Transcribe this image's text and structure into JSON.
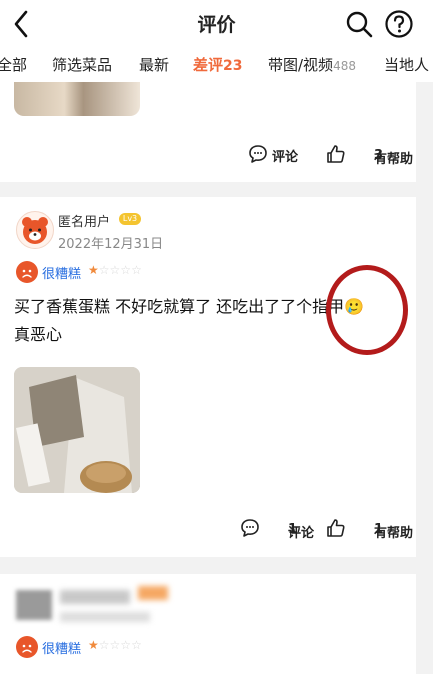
{
  "header": {
    "title": "评价"
  },
  "tabs": [
    {
      "label": "全部"
    },
    {
      "label": "筛选菜品"
    },
    {
      "label": "最新"
    },
    {
      "label": "差评",
      "count": "23"
    },
    {
      "label": "带图/视频",
      "count": "488"
    },
    {
      "label": "当地人"
    }
  ],
  "card1": {
    "comment_label": "评论",
    "helpful_label": "有帮助",
    "helpful_count": "3"
  },
  "review": {
    "username": "匿名用户",
    "level": "Lv3",
    "date": "2022年12月31日",
    "rating_label": "很糟糕",
    "rating": 1,
    "rating_max": 5,
    "text_line1": "买了香蕉蛋糕 不好吃就算了 还吃出了了个指甲🥲",
    "text_line2": "真恶心",
    "comment_label": "评论",
    "comment_count": "1",
    "helpful_label": "有帮助",
    "helpful_count": "1"
  },
  "card3": {
    "rating_label": "很糟糕",
    "rating": 1
  },
  "colors": {
    "accent": "#f06a3c",
    "annotation_circle": "#b31b1b",
    "rating_blue": "#2a6fe0"
  }
}
